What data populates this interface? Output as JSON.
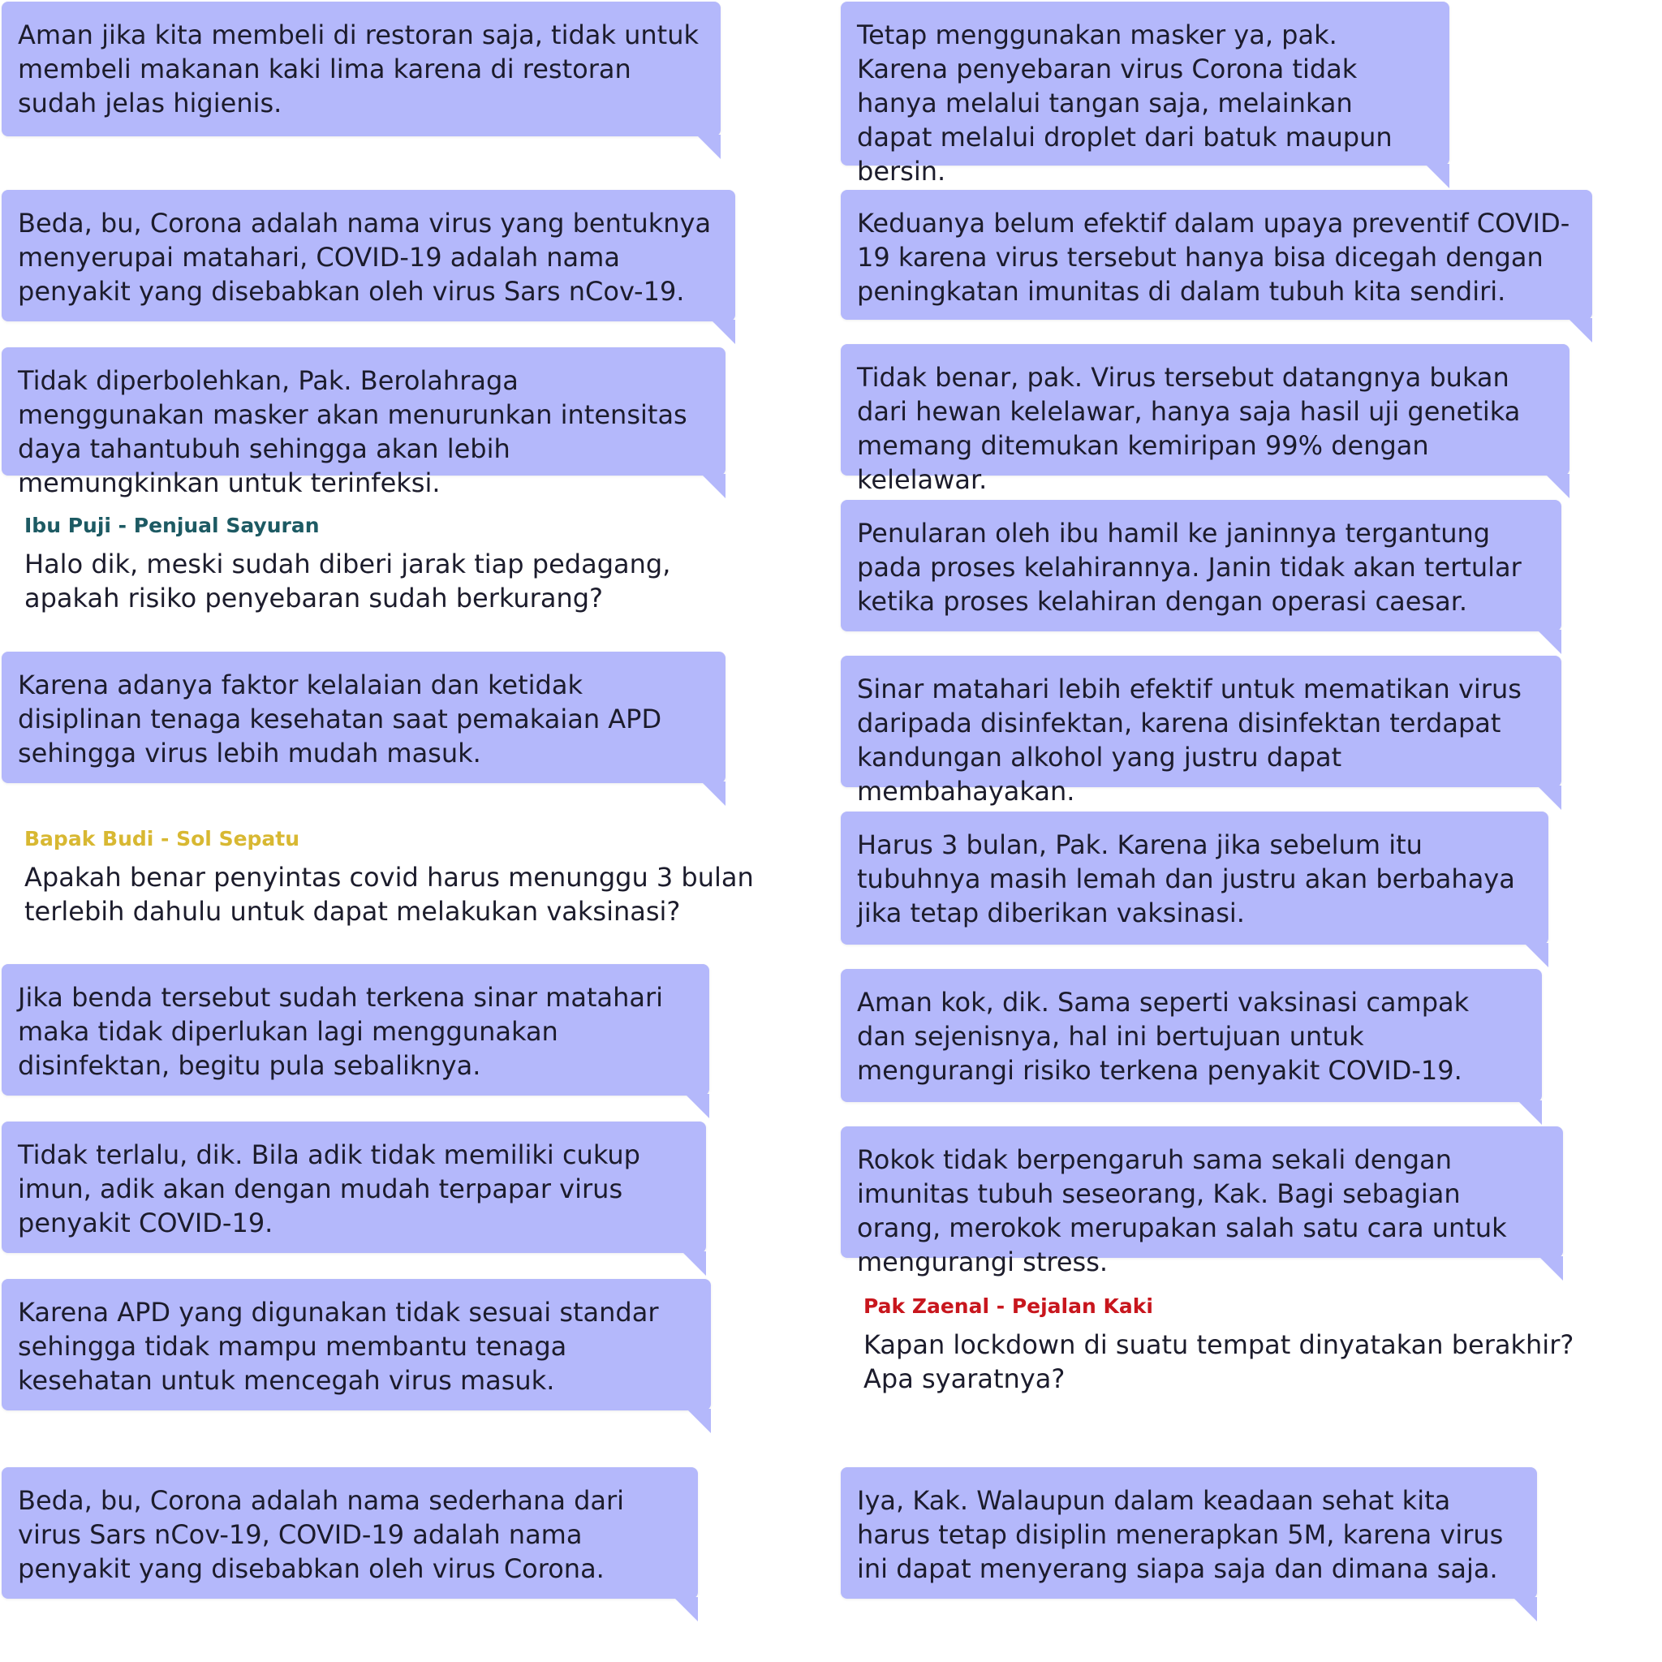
{
  "left": {
    "bubbles": [
      "Aman jika kita membeli di restoran saja, tidak untuk membeli makanan kaki lima karena di restoran sudah jelas higienis.",
      "Beda, bu, Corona adalah nama virus yang bentuknya menyerupai matahari, COVID-19 adalah nama penyakit yang disebabkan oleh virus Sars nCov-19.",
      "Tidak diperbolehkan, Pak. Berolahraga menggunakan masker akan menurunkan intensitas daya tahantubuh sehingga akan lebih memungkinkan untuk terinfeksi.",
      "Karena adanya faktor kelalaian dan ketidak disiplinan tenaga kesehatan saat pemakaian APD sehingga virus lebih mudah masuk.",
      "Jika benda tersebut sudah terkena sinar matahari maka tidak diperlukan lagi menggunakan disinfektan, begitu pula sebaliknya.",
      "Tidak terlalu, dik. Bila adik tidak memiliki cukup imun, adik akan dengan mudah terpapar virus penyakit COVID-19.",
      "Karena APD yang digunakan tidak sesuai standar sehingga tidak mampu membantu tenaga kesehatan untuk mencegah virus masuk.",
      "Beda, bu, Corona adalah nama sederhana dari virus Sars nCov-19, COVID-19 adalah nama penyakit yang disebabkan oleh virus Corona."
    ],
    "questions": [
      {
        "speaker": "Ibu Puji - Penjual Sayuran",
        "speaker_color": "#1d5a63",
        "text": "Halo dik, meski sudah diberi jarak tiap pedagang, apakah risiko penyebaran sudah berkurang?"
      },
      {
        "speaker": "Bapak Budi - Sol Sepatu",
        "speaker_color": "#d8b832",
        "text": "Apakah benar penyintas covid harus menunggu 3 bulan terlebih dahulu untuk dapat melakukan vaksinasi?"
      }
    ]
  },
  "right": {
    "bubbles": [
      "Tetap menggunakan masker ya, pak. Karena penyebaran virus Corona tidak hanya melalui tangan saja, melainkan dapat melalui droplet dari batuk maupun bersin.",
      "Keduanya belum efektif dalam upaya preventif COVID-19 karena virus tersebut hanya bisa dicegah dengan peningkatan imunitas di dalam tubuh kita sendiri.",
      "Tidak benar, pak. Virus tersebut datangnya bukan dari hewan kelelawar, hanya saja hasil uji genetika memang ditemukan kemiripan 99% dengan kelelawar.",
      "Penularan oleh ibu hamil ke janinnya tergantung pada proses kelahirannya. Janin tidak akan tertular ketika proses kelahiran dengan operasi caesar.",
      "Sinar matahari lebih efektif untuk mematikan virus daripada disinfektan, karena disinfektan terdapat kandungan alkohol yang justru dapat membahayakan.",
      "Harus 3 bulan, Pak. Karena jika sebelum itu tubuhnya masih lemah dan justru akan berbahaya jika tetap diberikan vaksinasi.",
      "Aman kok, dik. Sama seperti vaksinasi campak dan sejenisnya, hal ini bertujuan untuk mengurangi risiko terkena penyakit COVID-19.",
      "Rokok tidak berpengaruh sama sekali dengan imunitas tubuh seseorang, Kak.  Bagi sebagian orang, merokok merupakan salah satu cara untuk mengurangi stress.",
      "Iya, Kak. Walaupun dalam keadaan sehat kita harus tetap disiplin menerapkan 5M, karena virus ini dapat menyerang siapa saja dan dimana saja."
    ],
    "questions": [
      {
        "speaker": "Pak Zaenal - Pejalan Kaki",
        "speaker_color": "#c8161d",
        "text": "Kapan lockdown di suatu tempat dinyatakan berakhir? Apa syaratnya?"
      }
    ]
  }
}
